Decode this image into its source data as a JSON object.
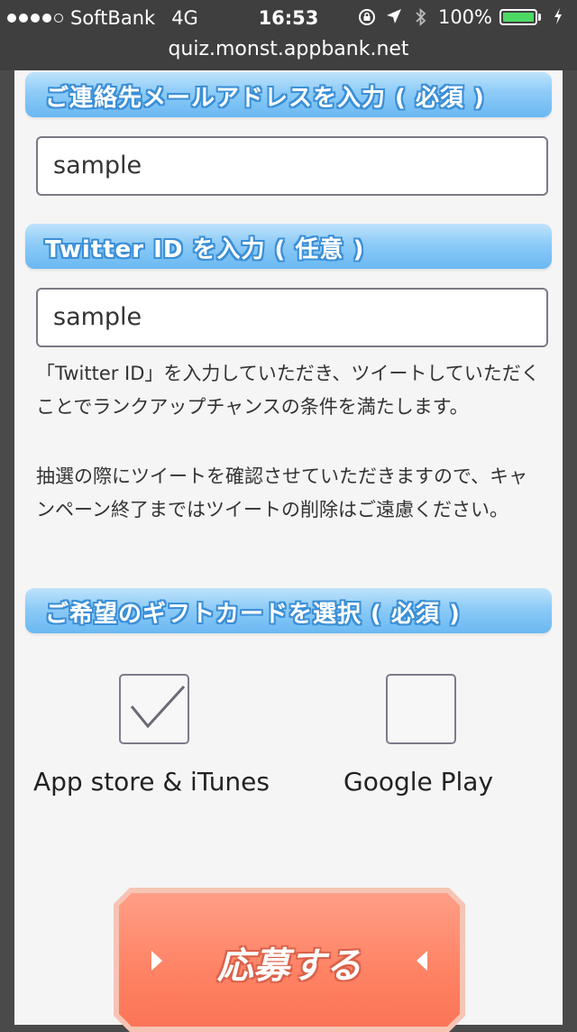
{
  "status_bar": {
    "carrier": "SoftBank",
    "network": "4G",
    "time": "16:53",
    "battery": "100%",
    "battery_color": "#4cd964",
    "icons": [
      "rotation-lock-icon",
      "location-arrow-icon",
      "bluetooth-icon",
      "battery-icon",
      "charging-icon"
    ]
  },
  "browser": {
    "url": "quiz.monst.appbank.net"
  },
  "form": {
    "email_header": "ご連絡先メールアドレスを入力 ( 必須 )",
    "email_value": "sample",
    "twitter_header": "Twitter ID を入力 ( 任意 )",
    "twitter_value": "sample",
    "note1": "「Twitter ID」を入力していただき、ツイートしていただくことでランクアップチャンスの条件を満たします。",
    "note2": "抽選の際にツイートを確認させていただきますので、キャンペーン終了まではツイートの削除はご遠慮ください。",
    "gift_header": "ご希望のギフトカードを選択 ( 必須 )",
    "options": [
      {
        "label": "App store & iTunes",
        "checked": true
      },
      {
        "label": "Google Play",
        "checked": false
      }
    ],
    "submit_label": "応募する"
  },
  "colors": {
    "header_blue": "#8ccbf7",
    "submit_orange": "#ff8264",
    "page_bg": "#f5f5f5"
  }
}
